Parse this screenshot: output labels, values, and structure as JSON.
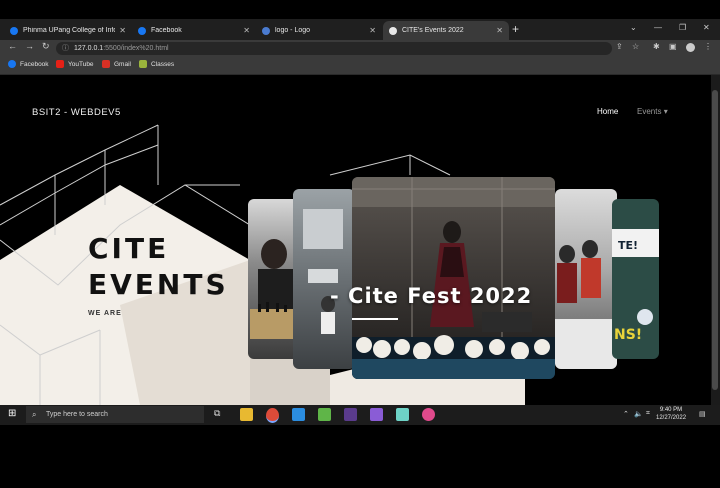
{
  "browser": {
    "tabs": [
      {
        "title": "Phinma UPang College of Inform",
        "favicon_color": "#1877f2"
      },
      {
        "title": "Facebook",
        "favicon_color": "#1877f2"
      },
      {
        "title": "logo - Logo",
        "favicon_color": "#4a7bd0"
      },
      {
        "title": "CITE's Events 2022",
        "favicon_color": "#e8e8e8"
      }
    ],
    "address": {
      "host": "127.0.0.1",
      "path": ":5500/index%20.html"
    },
    "bookmarks": [
      {
        "label": "Facebook",
        "color": "#1877f2"
      },
      {
        "label": "YouTube",
        "color": "#e62117"
      },
      {
        "label": "Gmail",
        "color": "#d93025"
      },
      {
        "label": "Classes",
        "color": "#9ab43c"
      }
    ]
  },
  "navbar": {
    "brand": "BSIT2 - WEBDEV5",
    "home": "Home",
    "events": "Events",
    "events_caret": "▾"
  },
  "hero": {
    "title_line1": "CITE",
    "title_line2": "EVENTS",
    "subtitle": "WE ARE"
  },
  "carousel": {
    "active_caption": "- Cite Fest 2022",
    "slides": [
      "chess-event",
      "hall-event",
      "cite-fest",
      "lab-event",
      "poster-event"
    ]
  },
  "taskbar": {
    "search_placeholder": "Type here to search",
    "time": "9:40 PM",
    "date": "12/27/2022"
  }
}
